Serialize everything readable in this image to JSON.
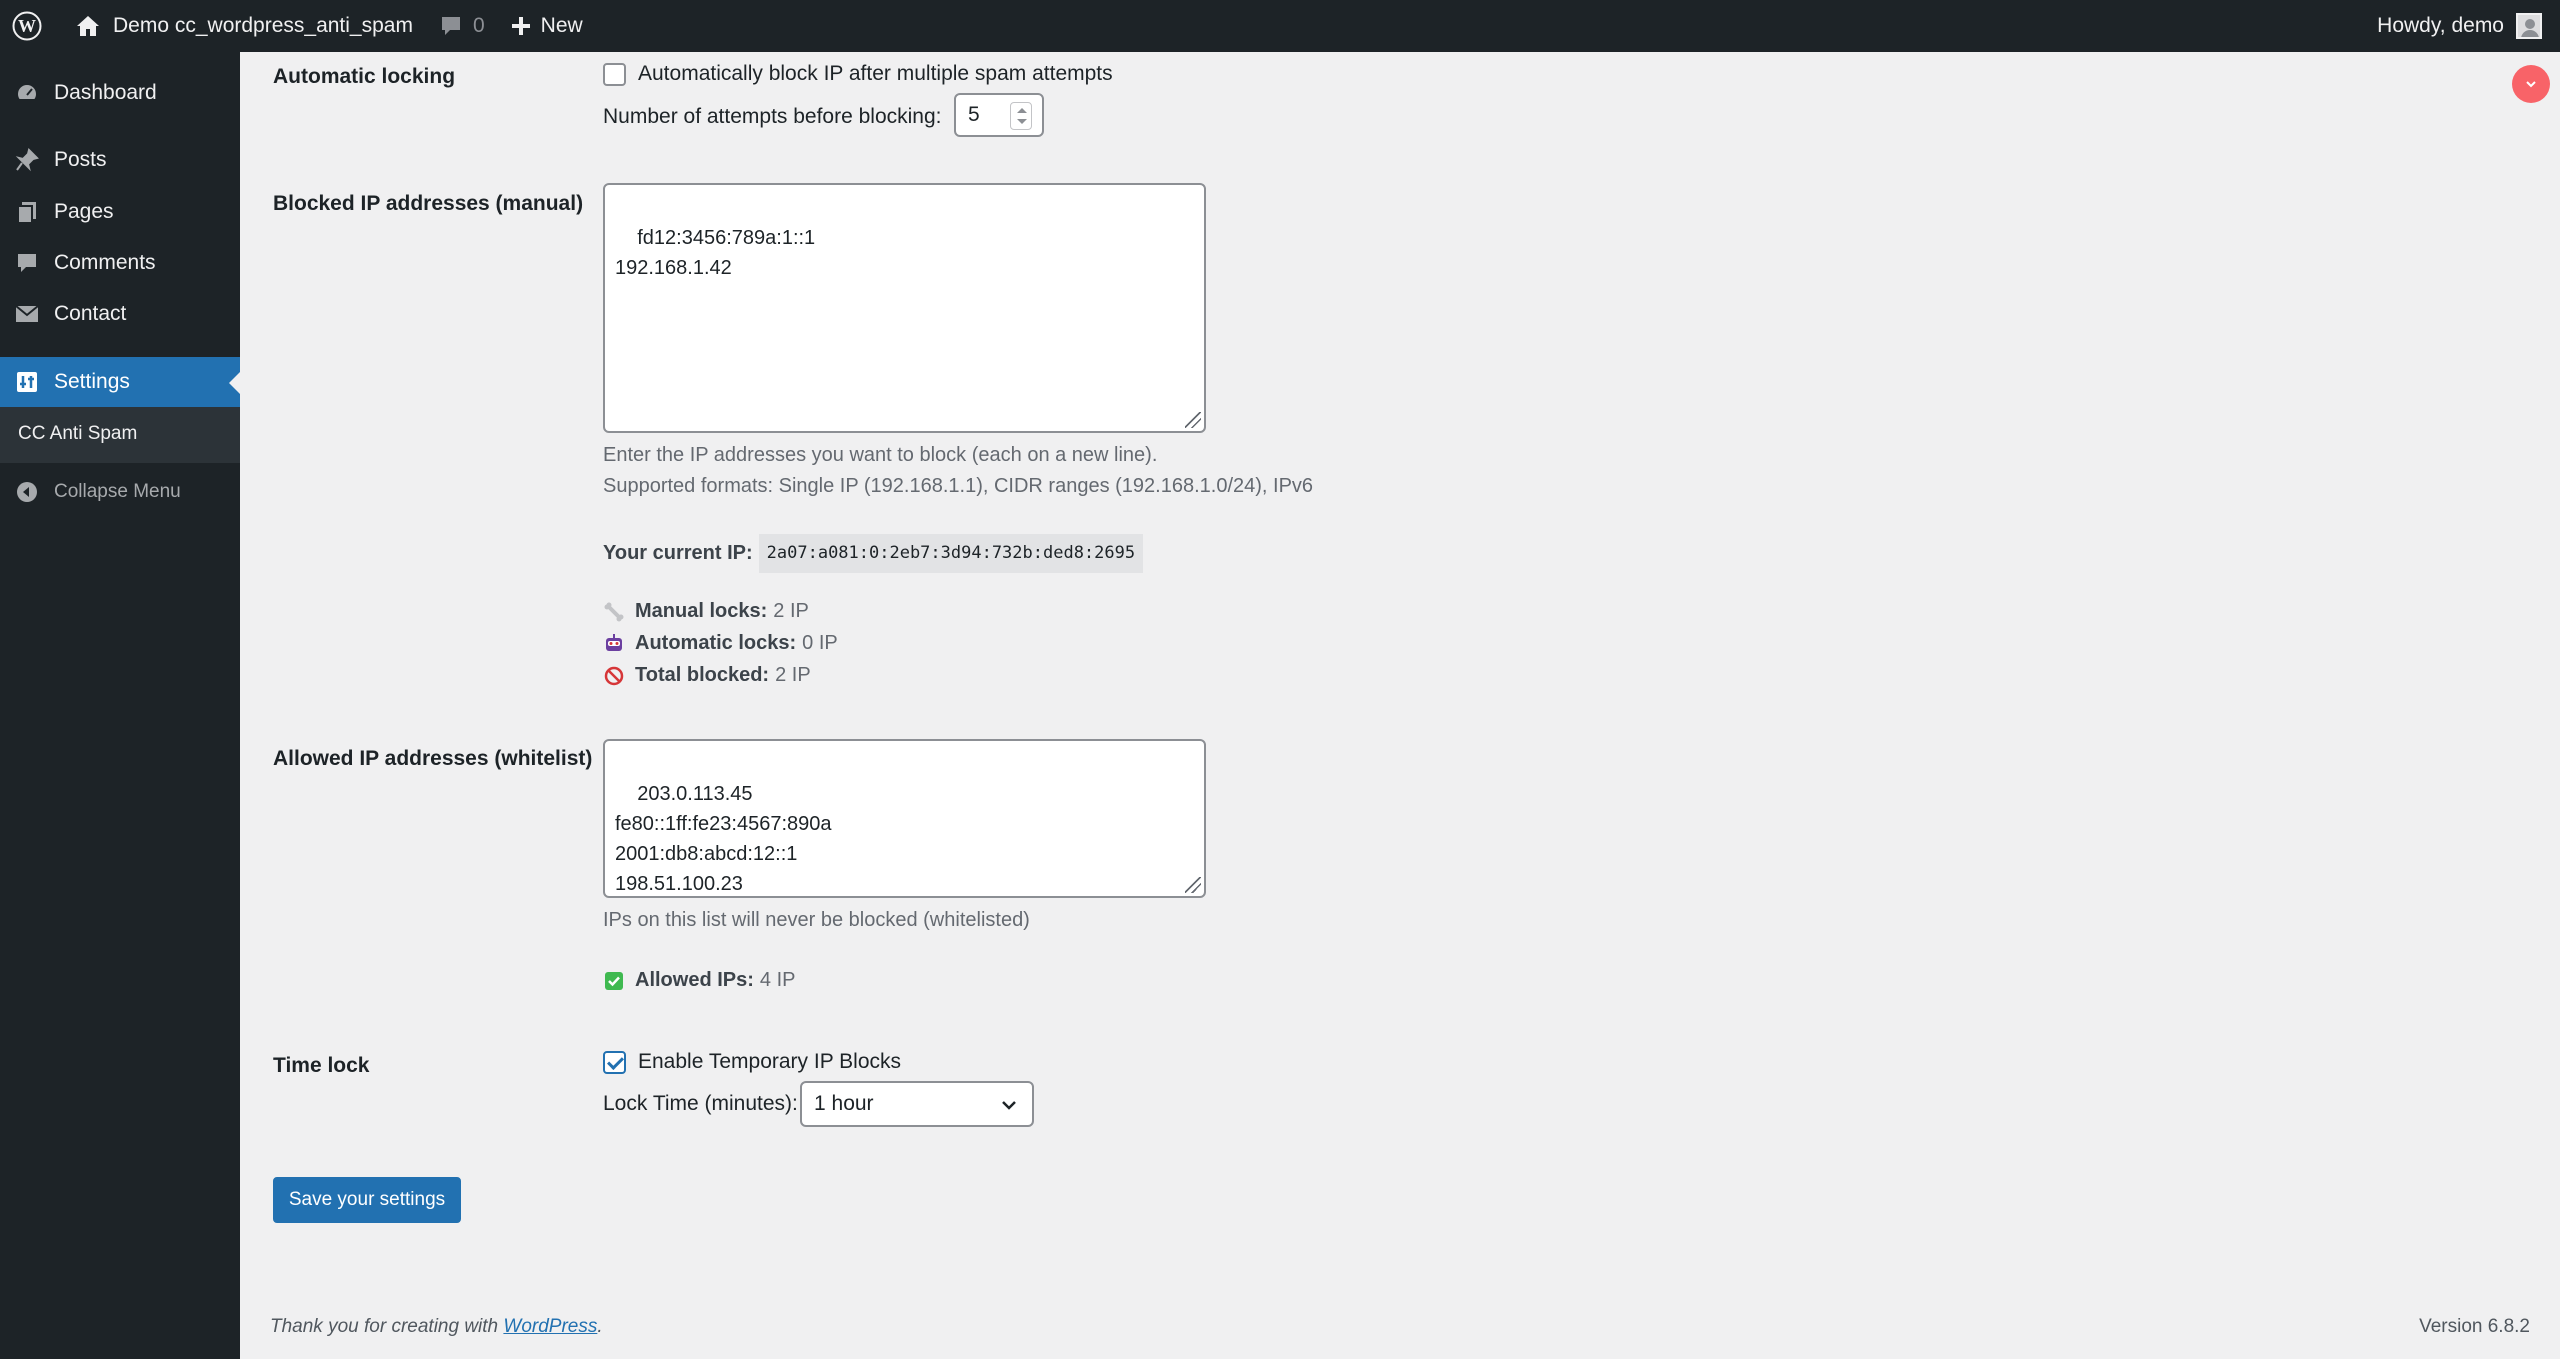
{
  "adminbar": {
    "site_name": "Demo cc_wordpress_anti_spam",
    "comment_count": "0",
    "new_label": "New",
    "howdy": "Howdy, demo"
  },
  "sidebar": {
    "items": [
      {
        "label": "Dashboard",
        "icon": "dashboard-icon"
      },
      {
        "label": "Posts",
        "icon": "pin-icon"
      },
      {
        "label": "Pages",
        "icon": "pages-icon"
      },
      {
        "label": "Comments",
        "icon": "comment-icon"
      },
      {
        "label": "Contact",
        "icon": "mail-icon"
      },
      {
        "label": "Settings",
        "icon": "settings-icon"
      }
    ],
    "submenu_label": "CC Anti Spam",
    "collapse_label": "Collapse Menu"
  },
  "auto_lock": {
    "label": "Automatic locking",
    "checkbox_label": "Automatically block IP after multiple spam attempts",
    "checked": false,
    "attempts_label": "Number of attempts before blocking:",
    "attempts_value": "5"
  },
  "blocked": {
    "label": "Blocked IP addresses (manual)",
    "value": "fd12:3456:789a:1::1\n192.168.1.42",
    "desc_line1": "Enter the IP addresses you want to block (each on a new line).",
    "desc_line2": "Supported formats: Single IP (192.168.1.1), CIDR ranges (192.168.1.0/24), IPv6",
    "current_ip_label": "Your current IP:",
    "current_ip": "2a07:a081:0:2eb7:3d94:732b:ded8:2695",
    "stats": [
      {
        "label": "Manual locks:",
        "value": "2 IP",
        "icon": "bone-icon"
      },
      {
        "label": "Automatic locks:",
        "value": "0 IP",
        "icon": "robot-icon"
      },
      {
        "label": "Total blocked:",
        "value": "2 IP",
        "icon": "prohibited-icon"
      }
    ]
  },
  "allowed": {
    "label": "Allowed IP addresses (whitelist)",
    "value": "203.0.113.45\nfe80::1ff:fe23:4567:890a\n2001:db8:abcd:12::1\n198.51.100.23",
    "desc": "IPs on this list will never be blocked (whitelisted)",
    "stat_label": "Allowed IPs:",
    "stat_value": "4 IP"
  },
  "time_lock": {
    "label": "Time lock",
    "checkbox_label": "Enable Temporary IP Blocks",
    "checked": true,
    "lock_time_label": "Lock Time (minutes):",
    "lock_time_value": "1 hour"
  },
  "save_label": "Save your settings",
  "footer": {
    "thanks_prefix": "Thank you for creating with ",
    "wp_link": "WordPress",
    "thanks_suffix": ".",
    "version": "Version 6.8.2"
  },
  "colors": {
    "admin_bg": "#1d2327",
    "accent": "#2271b1",
    "notification": "#f86368"
  }
}
